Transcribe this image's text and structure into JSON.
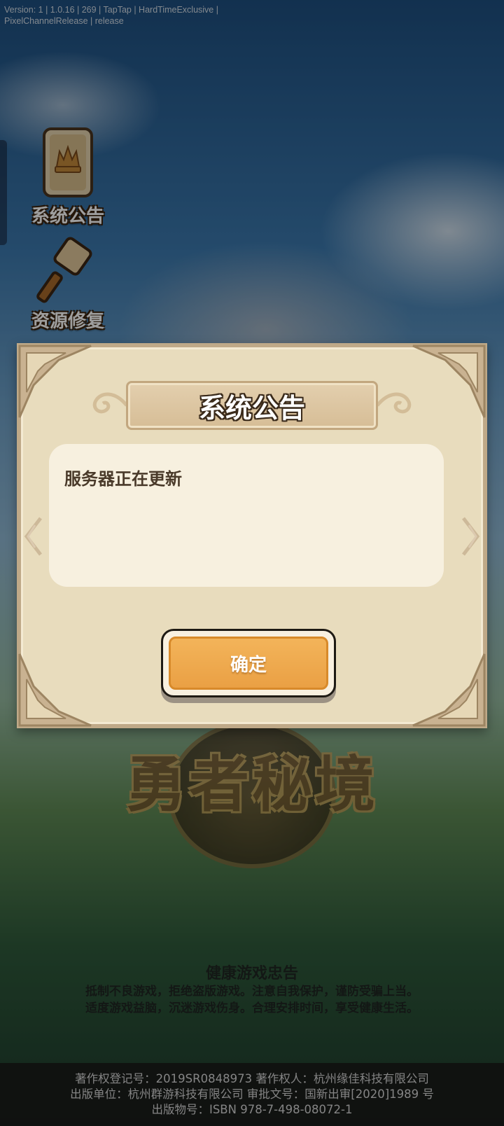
{
  "version_info": {
    "line1": "Version: 1 | 1.0.16 | 269 | TapTap | HardTimeExclusive |",
    "line2": "PixelChannelRelease | release"
  },
  "side_buttons": [
    {
      "label": "系统公告",
      "icon": "announcement-scroll-icon"
    },
    {
      "label": "资源修复",
      "icon": "repair-hammer-icon"
    }
  ],
  "dialog": {
    "title": "系统公告",
    "message": "服务器正在更新",
    "confirm_label": "确定"
  },
  "game_logo": {
    "text": "勇者秘境"
  },
  "health_notice": {
    "title": "健康游戏忠告",
    "line1": "抵制不良游戏，拒绝盗版游戏。注意自我保护，谨防受骗上当。",
    "line2": "适度游戏益脑，沉迷游戏伤身。合理安排时间，享受健康生活。"
  },
  "footer": {
    "line1": "著作权登记号：2019SR0848973 著作权人：杭州缘佳科技有限公司",
    "line2": "出版单位：杭州群游科技有限公司 审批文号：国新出审[2020]1989 号",
    "line3": "出版物号：ISBN 978-7-498-08072-1"
  },
  "colors": {
    "dialog_bg": "#e8dcbd",
    "dialog_border": "#bfa988",
    "confirm_button": "#f3b45a",
    "content_panel": "#f7f0df"
  }
}
